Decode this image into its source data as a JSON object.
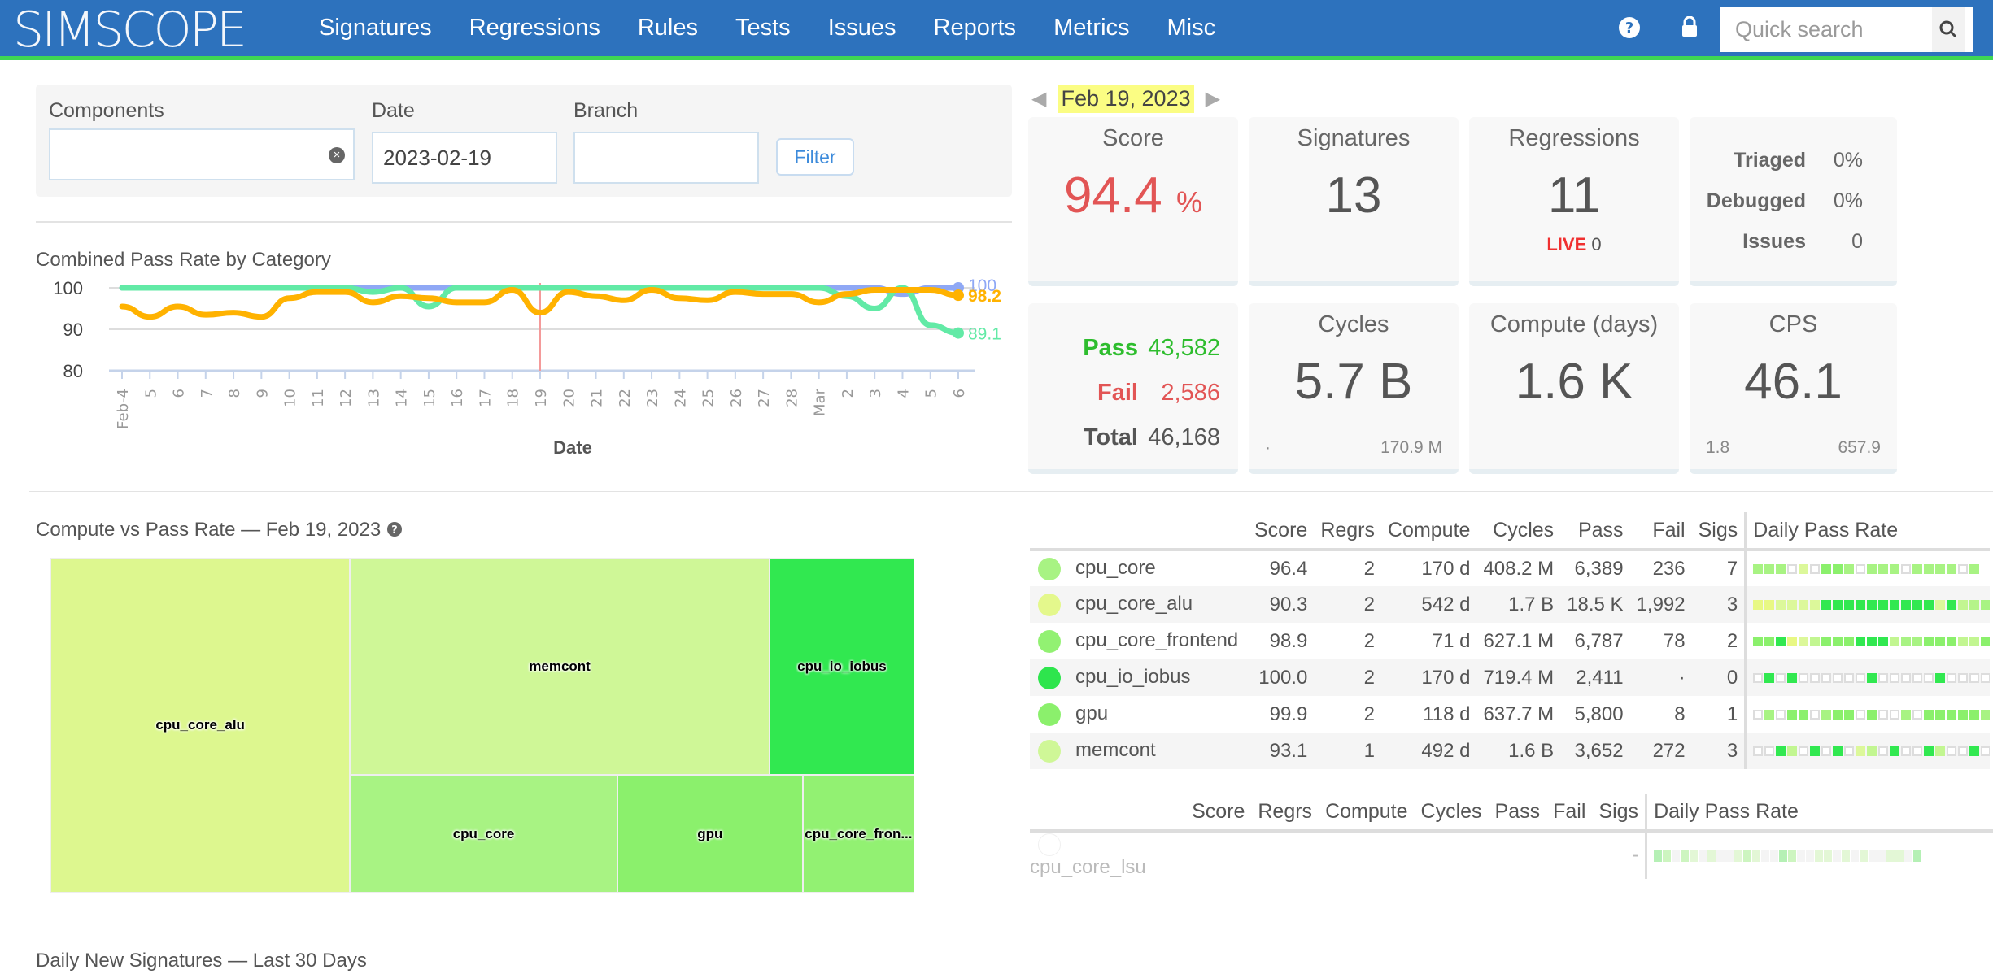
{
  "nav": {
    "logo": "SIMSCOPE",
    "menu": [
      "Signatures",
      "Regressions",
      "Rules",
      "Tests",
      "Issues",
      "Reports",
      "Metrics",
      "Misc"
    ],
    "help_icon": "?",
    "lock_icon": "lock",
    "search_placeholder": "Quick search"
  },
  "filters": {
    "components_label": "Components",
    "components_value": "",
    "date_label": "Date",
    "date_value": "2023-02-19",
    "branch_label": "Branch",
    "branch_value": "",
    "filter_button": "Filter"
  },
  "date_nav": {
    "current": "Feb 19, 2023"
  },
  "cards": {
    "score": {
      "title": "Score",
      "value": "94.4",
      "unit": "%"
    },
    "signatures": {
      "title": "Signatures",
      "value": "13"
    },
    "regressions": {
      "title": "Regressions",
      "value": "11",
      "live_label": "LIVE",
      "live_value": "0"
    },
    "triage": {
      "triaged_label": "Triaged",
      "triaged_value": "0%",
      "debugged_label": "Debugged",
      "debugged_value": "0%",
      "issues_label": "Issues",
      "issues_value": "0"
    },
    "counts": {
      "pass_label": "Pass",
      "pass_value": "43,582",
      "fail_label": "Fail",
      "fail_value": "2,586",
      "total_label": "Total",
      "total_value": "46,168"
    },
    "cycles": {
      "title": "Cycles",
      "value": "5.7 B",
      "min": "·",
      "max": "170.9 M"
    },
    "compute": {
      "title": "Compute (days)",
      "value": "1.6 K"
    },
    "cps": {
      "title": "CPS",
      "value": "46.1",
      "min": "1.8",
      "max": "657.9"
    }
  },
  "chart_data": [
    {
      "type": "line",
      "title": "Combined Pass Rate by Category",
      "xlabel": "Date",
      "ylabel": "",
      "ylim": [
        80,
        100
      ],
      "yticks": [
        "100",
        "90",
        "80"
      ],
      "x": [
        "Feb-4",
        "5",
        "6",
        "7",
        "8",
        "9",
        "10",
        "11",
        "12",
        "13",
        "14",
        "15",
        "16",
        "17",
        "18",
        "19",
        "20",
        "21",
        "22",
        "23",
        "24",
        "25",
        "26",
        "27",
        "28",
        "Mar",
        "2",
        "3",
        "4",
        "5",
        "6"
      ],
      "highlight_x": "19",
      "series": [
        {
          "name": "blue",
          "color": "#8fa8f5",
          "end_label": "100",
          "values": [
            100,
            100,
            100,
            100,
            100,
            100,
            100,
            100,
            100,
            100,
            100,
            100,
            100,
            100,
            100,
            100,
            100,
            100,
            100,
            100,
            100,
            100,
            100,
            100,
            100,
            100,
            100,
            100,
            98.5,
            100,
            100
          ]
        },
        {
          "name": "green",
          "color": "#62eaa6",
          "end_label": "89.1",
          "values": [
            100,
            100,
            100,
            100,
            100,
            100,
            100,
            100,
            100,
            99,
            100,
            95.5,
            100,
            100,
            100,
            100,
            100,
            100,
            100,
            100,
            100,
            100,
            100,
            100,
            100,
            100,
            98,
            95,
            100,
            91,
            89.1
          ]
        },
        {
          "name": "orange",
          "color": "#ffb200",
          "end_label": "98.2",
          "values": [
            95.5,
            93,
            95.5,
            93.5,
            94,
            93,
            97.5,
            99,
            99,
            96.5,
            98,
            97.5,
            96.5,
            96.5,
            99.5,
            94,
            99,
            98,
            97,
            99.5,
            97.5,
            97,
            99,
            98.5,
            98.5,
            96.5,
            98.5,
            99.5,
            99.5,
            99.5,
            98.2
          ]
        }
      ]
    },
    {
      "type": "treemap",
      "title": "Compute vs Pass Rate — Feb 19, 2023",
      "items": [
        {
          "name": "cpu_core_alu",
          "label": "cpu_core_alu",
          "compute_days": 542,
          "color": "#ddf78f"
        },
        {
          "name": "memcont",
          "label": "memcont",
          "compute_days": 492,
          "color": "#cff797"
        },
        {
          "name": "cpu_io_iobus",
          "label": "cpu_io_iobus",
          "compute_days": 170,
          "color": "#31e850"
        },
        {
          "name": "cpu_core",
          "label": "cpu_core",
          "compute_days": 170,
          "color": "#a8f383"
        },
        {
          "name": "gpu",
          "label": "gpu",
          "compute_days": 118,
          "color": "#8bf06c"
        },
        {
          "name": "cpu_core_frontend",
          "label": "cpu_core_fron...",
          "compute_days": 71,
          "color": "#92f172"
        }
      ]
    }
  ],
  "treemap_section": {
    "title": "Compute vs Pass Rate — Feb 19, 2023"
  },
  "table": {
    "headers": [
      "",
      "Score",
      "Regrs",
      "Compute",
      "Cycles",
      "Pass",
      "Fail",
      "Sigs",
      "Daily Pass Rate"
    ],
    "rows": [
      {
        "name": "cpu_core",
        "dot": "#a8f383",
        "score": "96.4",
        "regrs": "2",
        "compute": "170 d",
        "cycles": "408.2 M",
        "pass": "6,389",
        "fail": "236",
        "sigs": "7",
        "cells": "bbbeaeccbebbbebbbbeb"
      },
      {
        "name": "cpu_core_alu",
        "dot": "#e4f88c",
        "score": "90.3",
        "regrs": "2",
        "compute": "542 d",
        "cycles": "1.7 B",
        "pass": "18.5 K",
        "fail": "1,992",
        "sigs": "3",
        "cells": "yyaaaaddddddddddadfgbb"
      },
      {
        "name": "cpu_core_frontend",
        "dot": "#92f172",
        "score": "98.9",
        "regrs": "2",
        "compute": "71 d",
        "cycles": "627.1 M",
        "pass": "6,787",
        "fail": "78",
        "sigs": "2",
        "cells": "ccdyafcccdddfbbcccffc"
      },
      {
        "name": "cpu_io_iobus",
        "dot": "#2ee54d",
        "score": "100.0",
        "regrs": "2",
        "compute": "170 d",
        "cycles": "719.4 M",
        "pass": "2,411",
        "fail": "·",
        "sigs": "0",
        "cells": "ededeeeeeedeeeeedeeeee"
      },
      {
        "name": "gpu",
        "dot": "#8bf06c",
        "score": "99.9",
        "regrs": "2",
        "compute": "118 d",
        "cycles": "637.7 M",
        "pass": "5,800",
        "fail": "8",
        "sigs": "1",
        "cells": "ebeccebcceceebecccccb"
      },
      {
        "name": "memcont",
        "dot": "#cff797",
        "score": "93.1",
        "regrs": "1",
        "compute": "492 d",
        "cycles": "1.6 B",
        "pass": "3,652",
        "fail": "272",
        "sigs": "3",
        "cells": "eedfededeafedeedfeedeye"
      }
    ]
  },
  "table2": {
    "headers": [
      "",
      "Score",
      "Regrs",
      "Compute",
      "Cycles",
      "Pass",
      "Fail",
      "Sigs",
      "Daily Pass Rate"
    ],
    "rows": [
      {
        "name": "cpu_core_lsu",
        "score": "",
        "regrs": "",
        "compute": "",
        "cycles": "",
        "pass": "",
        "fail": "",
        "sigs": "-"
      }
    ]
  },
  "bottom_section": {
    "title": "Daily New Signatures — Last 30 Days"
  },
  "cell_colors": {
    "a": "#dcf89a",
    "b": "#a8f383",
    "c": "#8bf06c",
    "d": "#31e850",
    "e": "empty",
    "f": "#c2f691",
    "g": "#b5f48a",
    "y": "#e8f884"
  }
}
